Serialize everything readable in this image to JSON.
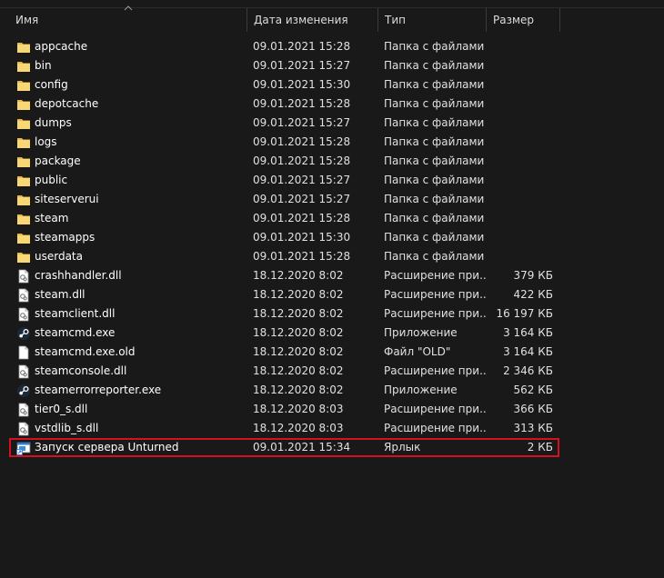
{
  "columns": {
    "name": "Имя",
    "date": "Дата изменения",
    "type": "Тип",
    "size": "Размер"
  },
  "files": [
    {
      "name": "appcache",
      "date": "09.01.2021 15:28",
      "type": "Папка с файлами",
      "size": "",
      "icon": "folder-icon"
    },
    {
      "name": "bin",
      "date": "09.01.2021 15:27",
      "type": "Папка с файлами",
      "size": "",
      "icon": "folder-icon"
    },
    {
      "name": "config",
      "date": "09.01.2021 15:30",
      "type": "Папка с файлами",
      "size": "",
      "icon": "folder-icon"
    },
    {
      "name": "depotcache",
      "date": "09.01.2021 15:28",
      "type": "Папка с файлами",
      "size": "",
      "icon": "folder-icon"
    },
    {
      "name": "dumps",
      "date": "09.01.2021 15:27",
      "type": "Папка с файлами",
      "size": "",
      "icon": "folder-icon"
    },
    {
      "name": "logs",
      "date": "09.01.2021 15:28",
      "type": "Папка с файлами",
      "size": "",
      "icon": "folder-icon"
    },
    {
      "name": "package",
      "date": "09.01.2021 15:28",
      "type": "Папка с файлами",
      "size": "",
      "icon": "folder-icon"
    },
    {
      "name": "public",
      "date": "09.01.2021 15:27",
      "type": "Папка с файлами",
      "size": "",
      "icon": "folder-icon"
    },
    {
      "name": "siteserverui",
      "date": "09.01.2021 15:27",
      "type": "Папка с файлами",
      "size": "",
      "icon": "folder-icon"
    },
    {
      "name": "steam",
      "date": "09.01.2021 15:28",
      "type": "Папка с файлами",
      "size": "",
      "icon": "folder-icon"
    },
    {
      "name": "steamapps",
      "date": "09.01.2021 15:30",
      "type": "Папка с файлами",
      "size": "",
      "icon": "folder-icon"
    },
    {
      "name": "userdata",
      "date": "09.01.2021 15:28",
      "type": "Папка с файлами",
      "size": "",
      "icon": "folder-icon"
    },
    {
      "name": "crashhandler.dll",
      "date": "18.12.2020 8:02",
      "type": "Расширение при...",
      "size": "379 КБ",
      "icon": "dll-file-icon"
    },
    {
      "name": "steam.dll",
      "date": "18.12.2020 8:02",
      "type": "Расширение при...",
      "size": "422 КБ",
      "icon": "dll-file-icon"
    },
    {
      "name": "steamclient.dll",
      "date": "18.12.2020 8:02",
      "type": "Расширение при...",
      "size": "16 197 КБ",
      "icon": "dll-file-icon"
    },
    {
      "name": "steamcmd.exe",
      "date": "18.12.2020 8:02",
      "type": "Приложение",
      "size": "3 164 КБ",
      "icon": "steam-app-icon"
    },
    {
      "name": "steamcmd.exe.old",
      "date": "18.12.2020 8:02",
      "type": "Файл \"OLD\"",
      "size": "3 164 КБ",
      "icon": "generic-file-icon"
    },
    {
      "name": "steamconsole.dll",
      "date": "18.12.2020 8:02",
      "type": "Расширение при...",
      "size": "2 346 КБ",
      "icon": "dll-file-icon"
    },
    {
      "name": "steamerrorreporter.exe",
      "date": "18.12.2020 8:02",
      "type": "Приложение",
      "size": "562 КБ",
      "icon": "steam-app-icon"
    },
    {
      "name": "tier0_s.dll",
      "date": "18.12.2020 8:03",
      "type": "Расширение при...",
      "size": "366 КБ",
      "icon": "dll-file-icon"
    },
    {
      "name": "vstdlib_s.dll",
      "date": "18.12.2020 8:03",
      "type": "Расширение при...",
      "size": "313 КБ",
      "icon": "dll-file-icon"
    },
    {
      "name": "Запуск сервера Unturned",
      "date": "09.01.2021 15:34",
      "type": "Ярлык",
      "size": "2 КБ",
      "icon": "shortcut-icon",
      "selected": true
    }
  ],
  "colors": {
    "background": "#191919",
    "folder": "#f8d775",
    "highlight": "#d7101f"
  }
}
